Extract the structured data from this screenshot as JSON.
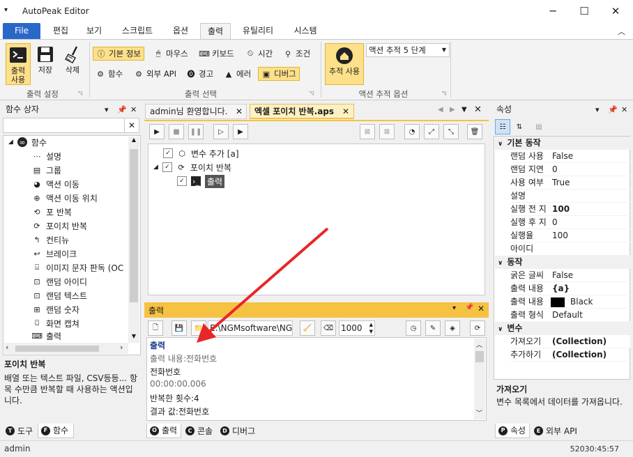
{
  "window": {
    "title": "AutoPeak Editor",
    "system_menu_icon": "window-menu-icon",
    "minimize": "─",
    "maximize": "☐",
    "close": "✕"
  },
  "menu": {
    "tabs": [
      "File",
      "편집",
      "보기",
      "스크립트",
      "옵션",
      "출력",
      "유틸리티",
      "시스템"
    ],
    "active": "출력",
    "collapse_icon": "chevron-up-icon"
  },
  "ribbon": {
    "output_settings": {
      "label": "출력 설정",
      "use": "출력\n사용",
      "use_line1": "출력",
      "use_line2": "사용",
      "save": "저장",
      "delete": "삭제"
    },
    "output_select": {
      "label": "출력 선택",
      "items": [
        "기본 정보",
        "마우스",
        "키보드",
        "시간",
        "조건",
        "함수",
        "외부 API",
        "경고",
        "에러",
        "디버그"
      ],
      "highlighted": [
        "기본 정보",
        "디버그"
      ]
    },
    "action_trace": {
      "label": "액션 추적 옵션",
      "use": "추적 사용",
      "level_value": "액션 추적 5 단계"
    }
  },
  "function_box": {
    "title": "함수 상자",
    "search_value": "",
    "clear": "✕",
    "root": "함수",
    "items": [
      "설명",
      "그룹",
      "액션 이동",
      "액션 이동 위치",
      "포 반복",
      "포이치 반복",
      "컨티뉴",
      "브레이크",
      "이미지 문자 판독 (OC",
      "랜덤 아이디",
      "랜덤 텍스트",
      "랜덤 숫자",
      "화면 캡쳐",
      "출력"
    ],
    "desc_title": "포이치 반복",
    "desc_text": "배열 또는 텍스트 파일, CSV등등... 항목 수만큼 반복할 때 사용하는 액션입니다."
  },
  "doc_tabs": [
    {
      "label": "admin님 환영합니다."
    },
    {
      "label": "엑셀 포이치 반복.aps"
    }
  ],
  "script_tree": {
    "items": [
      "변수 추가 [a]",
      "포이치 반복",
      "출력"
    ]
  },
  "output_panel": {
    "title": "출력",
    "path_value": "E:\\NGMsoftware\\NG",
    "count_value": "1000",
    "lines": [
      "출력",
      "출력 내용:전화번호",
      "전화번호",
      "00:00:00.006",
      "반복한 횟수:4",
      "결과 값:전화번호"
    ]
  },
  "properties": {
    "title": "속성",
    "categories": [
      {
        "name": "기본 동작",
        "rows": [
          [
            "랜덤 사용",
            "False"
          ],
          [
            "랜덤 지연",
            "0"
          ],
          [
            "사용 여부",
            "True"
          ],
          [
            "설명",
            ""
          ],
          [
            "실행 전 지",
            "100"
          ],
          [
            "실행 후 지",
            "0"
          ],
          [
            "실행율",
            "100"
          ],
          [
            "아이디",
            ""
          ]
        ]
      },
      {
        "name": "동작",
        "rows": [
          [
            "굵은 글씨",
            "False"
          ],
          [
            "출력 내용",
            "{a}"
          ],
          [
            "출력 내용",
            "Black"
          ],
          [
            "출력 형식",
            "Default"
          ]
        ]
      },
      {
        "name": "변수",
        "rows": [
          [
            "가져오기",
            "(Collection)"
          ],
          [
            "추가하기",
            "(Collection)"
          ]
        ]
      }
    ],
    "desc_title": "가져오기",
    "desc_text": "변수 목록에서 데이터를 가져옵니다."
  },
  "bottom_tabs": {
    "left": [
      "도구",
      "함수"
    ],
    "left_keys": [
      "T",
      "F"
    ],
    "mid": [
      "출력",
      "콘솔",
      "디버그"
    ],
    "mid_keys": [
      "O",
      "C",
      "D"
    ],
    "right": [
      "속성",
      "외부 API"
    ],
    "right_keys": [
      "P",
      "E"
    ]
  },
  "status": {
    "user": "admin",
    "time": "52030:45:57"
  },
  "colors": {
    "file_tab": "#2a68c8",
    "highlight": "#fde08a",
    "arrow": "#e8262a",
    "output_head": "#1f3c8c"
  }
}
